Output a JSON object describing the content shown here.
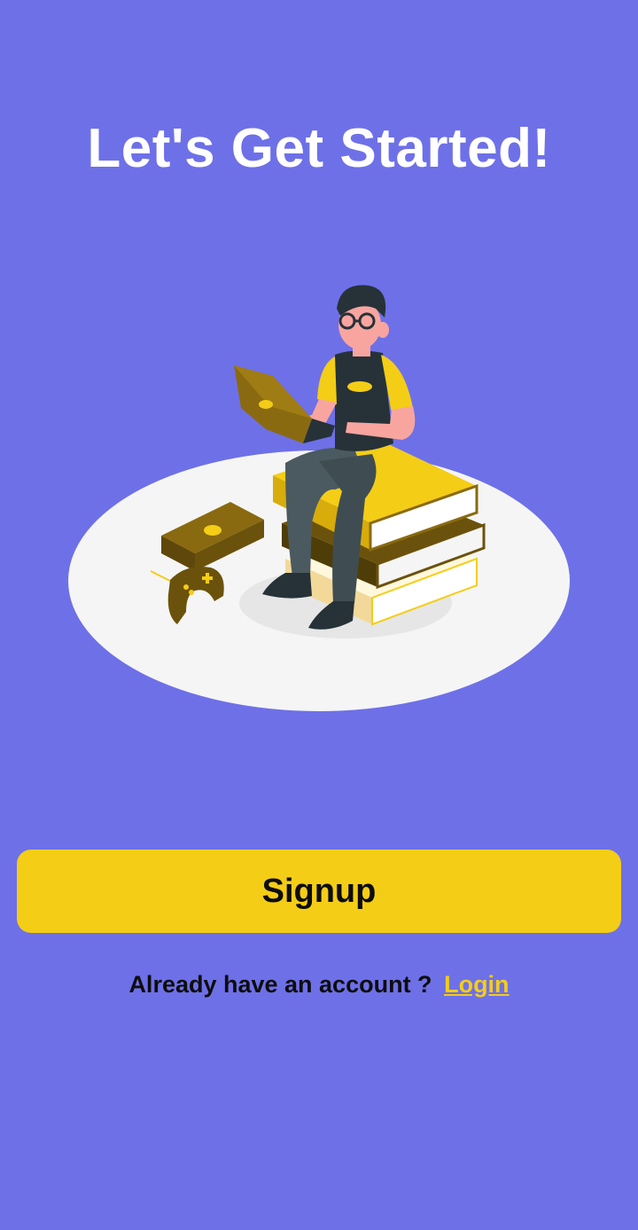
{
  "header": {
    "title": "Let's Get Started!"
  },
  "hero": {
    "illustration": "person-sitting-on-books-with-laptop-illustration"
  },
  "actions": {
    "signup_label": "Signup",
    "account_prompt": "Already have an account ?",
    "login_label": "Login"
  },
  "colors": {
    "background": "#6e70e8",
    "accent": "#f4cd16",
    "text_dark": "#0d0d0d",
    "text_light": "#ffffff"
  }
}
